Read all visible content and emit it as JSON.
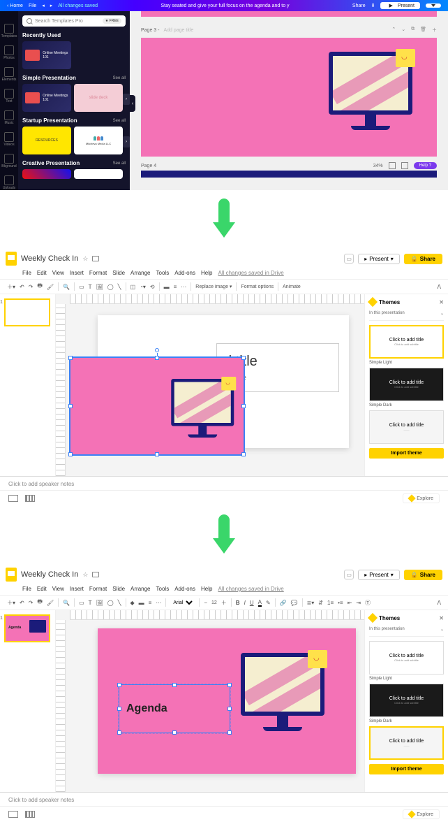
{
  "canva": {
    "topbar": {
      "undo": "◂",
      "redo": "▸",
      "saved": "All changes saved",
      "marquee": "Stay seated and give your full focus on the agenda and to y",
      "share": "Share",
      "download": "⬇",
      "present": "▶ Present"
    },
    "rail": [
      "Photos",
      "Elements",
      "Text",
      "Music",
      "Videos",
      "Bkground",
      "Uploads"
    ],
    "search": {
      "placeholder": "Search Templates Pro",
      "pill": "★ FREE"
    },
    "sections": {
      "recent": {
        "title": "Recently Used",
        "see": "",
        "items": [
          "Online Meetings 101"
        ]
      },
      "simple": {
        "title": "Simple Presentation",
        "see": "See all",
        "items": [
          "Online Meetings 101",
          "slide deck"
        ]
      },
      "startup": {
        "title": "Startup Presentation",
        "see": "See all",
        "items": [
          "RESOURCES",
          "Milcheva Media LLC"
        ]
      },
      "creative": {
        "title": "Creative Presentation",
        "see": "See all"
      }
    },
    "canvas": {
      "page3_label": "Page 3 -",
      "page3_placeholder": "Add page title",
      "page4_label": "Page 4",
      "zoom": "34%",
      "help": "Help ?"
    }
  },
  "gs": {
    "doc_name": "Weekly Check In",
    "menus": [
      "File",
      "Edit",
      "View",
      "Insert",
      "Format",
      "Slide",
      "Arrange",
      "Tools",
      "Add-ons",
      "Help"
    ],
    "saved": "All changes saved in Drive",
    "present": "Present",
    "share": "Share",
    "toolbar_image": {
      "replace": "Replace image ▾",
      "format_opts": "Format options",
      "animate": "Animate"
    },
    "toolbar_text": {
      "font": "Arial",
      "size": "12"
    },
    "slide2": {
      "title_ph": "d title",
      "subtitle_ph": "ubtitle"
    },
    "slide3": {
      "agenda": "Agenda"
    },
    "notes_ph": "Click to add speaker notes",
    "explore": "Explore",
    "themes": {
      "heading": "Themes",
      "sub": "In this presentation",
      "card_title": "Click to add title",
      "card_sub": "Click to add subtitle",
      "light": "Simple Light",
      "dark": "Simple Dark",
      "import": "Import theme"
    }
  }
}
